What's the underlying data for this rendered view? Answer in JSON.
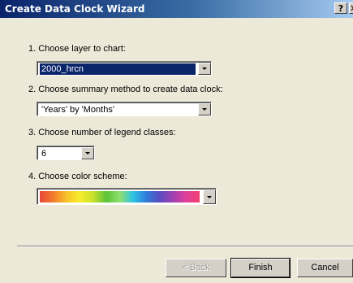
{
  "window": {
    "title": "Create Data Clock Wizard",
    "help_label": "?",
    "close_label": "✕"
  },
  "steps": {
    "layer": {
      "label": "1. Choose layer to chart:",
      "value": "2000_hrcn"
    },
    "summary": {
      "label": "2. Choose summary method to create data clock:",
      "value": "'Years' by 'Months'"
    },
    "classes": {
      "label": "3. Choose number of legend classes:",
      "value": "6"
    },
    "color": {
      "label": "4. Choose color scheme:",
      "ramp_colors": [
        "#e8483a",
        "#f27a2c",
        "#f8c12a",
        "#f7ed2c",
        "#c9e02b",
        "#5cc338",
        "#8fe06e",
        "#2ec4e6",
        "#2f7bd8",
        "#5a4cc1",
        "#a040b0",
        "#e0409a",
        "#f04070"
      ]
    }
  },
  "buttons": {
    "back": "< Back",
    "finish": "Finish",
    "cancel": "Cancel"
  },
  "colors": {
    "title_gradient_start": "#0a246a",
    "title_gradient_end": "#a6caf0",
    "dialog_bg": "#ece9d8",
    "selection_bg": "#0a246a"
  }
}
